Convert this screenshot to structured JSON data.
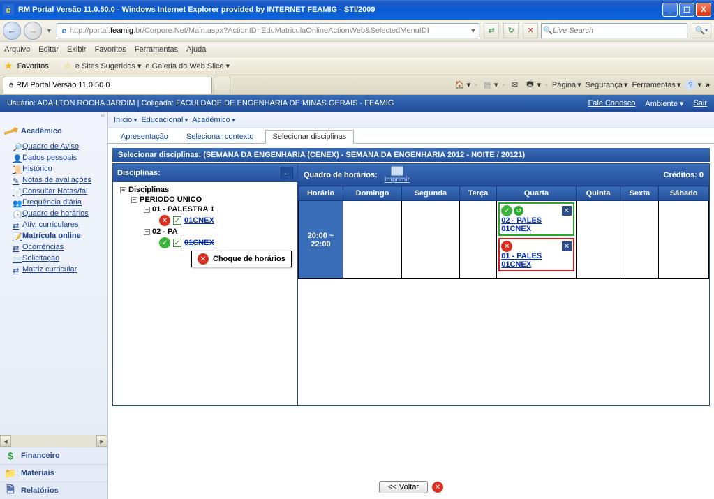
{
  "window": {
    "title": "RM Portal Versão 11.0.50.0 - Windows Internet Explorer provided by INTERNET FEAMIG - STI/2009"
  },
  "address": {
    "host": "http://portal.",
    "domain": "feamig",
    "rest": ".br/Corpore.Net/Main.aspx?ActionID=EduMatriculaOnlineActionWeb&SelectedMenuIDI"
  },
  "search": {
    "placeholder": "Live Search"
  },
  "menu": {
    "arquivo": "Arquivo",
    "editar": "Editar",
    "exibir": "Exibir",
    "favoritos": "Favoritos",
    "ferramentas": "Ferramentas",
    "ajuda": "Ajuda"
  },
  "favbar": {
    "label": "Favoritos",
    "sites": "Sites Sugeridos",
    "webslice": "Galeria do Web Slice"
  },
  "pagetab": {
    "title": "RM Portal Versão 11.0.50.0"
  },
  "cmdbar": {
    "pagina": "Página",
    "seg": "Segurança",
    "ferr": "Ferramentas"
  },
  "userbar": {
    "left": "Usuário: ADAILTON ROCHA JARDIM  |  Coligada: FACULDADE DE ENGENHARIA DE MINAS GERAIS - FEAMIG",
    "fale": "Fale Conosco",
    "amb": "Ambiente",
    "sair": "Sair"
  },
  "crumbs": {
    "inicio": "Início",
    "edu": "Educacional",
    "acad": "Acadêmico"
  },
  "subtabs": {
    "apres": "Apresentação",
    "selctx": "Selecionar contexto",
    "seldisc": "Selecionar disciplinas"
  },
  "sidebar": {
    "header": "Acadêmico",
    "items": [
      "Quadro de Aviso",
      "Dados pessoais",
      "Histórico",
      "Notas de avaliações",
      "Consultar Notas/fal",
      "Frequência diária",
      "Quadro de horários",
      "Ativ. curriculares",
      "Matrícula online",
      "Ocorrências",
      "Solicitação",
      "Matriz curricular"
    ],
    "financeiro": "Financeiro",
    "materiais": "Materiais",
    "relatorios": "Relatórios"
  },
  "mainhdr": "Selecionar disciplinas: (SEMANA DA ENGENHARIA (CENEX) - SEMANA DA ENGENHARIA 2012 - NOITE / 20121)",
  "tree": {
    "header": "Disciplinas:",
    "root": "Disciplinas",
    "period": "PERIODO UNICO",
    "p1": "01 - PALESTRA 1",
    "p1_turma": "01CNEX",
    "p2": "02 - PA",
    "p2_turma": "01CNEX",
    "tooltip": "Choque de horários"
  },
  "schedule": {
    "header": "Quadro de horários:",
    "print": "Imprimir",
    "credits": "Créditos: 0",
    "cols": [
      "Horário",
      "Domingo",
      "Segunda",
      "Terça",
      "Quarta",
      "Quinta",
      "Sexta",
      "Sábado"
    ],
    "time": "20:00 ~ 22:00",
    "slot1": {
      "line1": "02 - PALES",
      "line2": "01CNEX"
    },
    "slot2": {
      "line1": "01 - PALES",
      "line2": "01CNEX"
    }
  },
  "bottom": {
    "voltar": "<< Voltar"
  }
}
